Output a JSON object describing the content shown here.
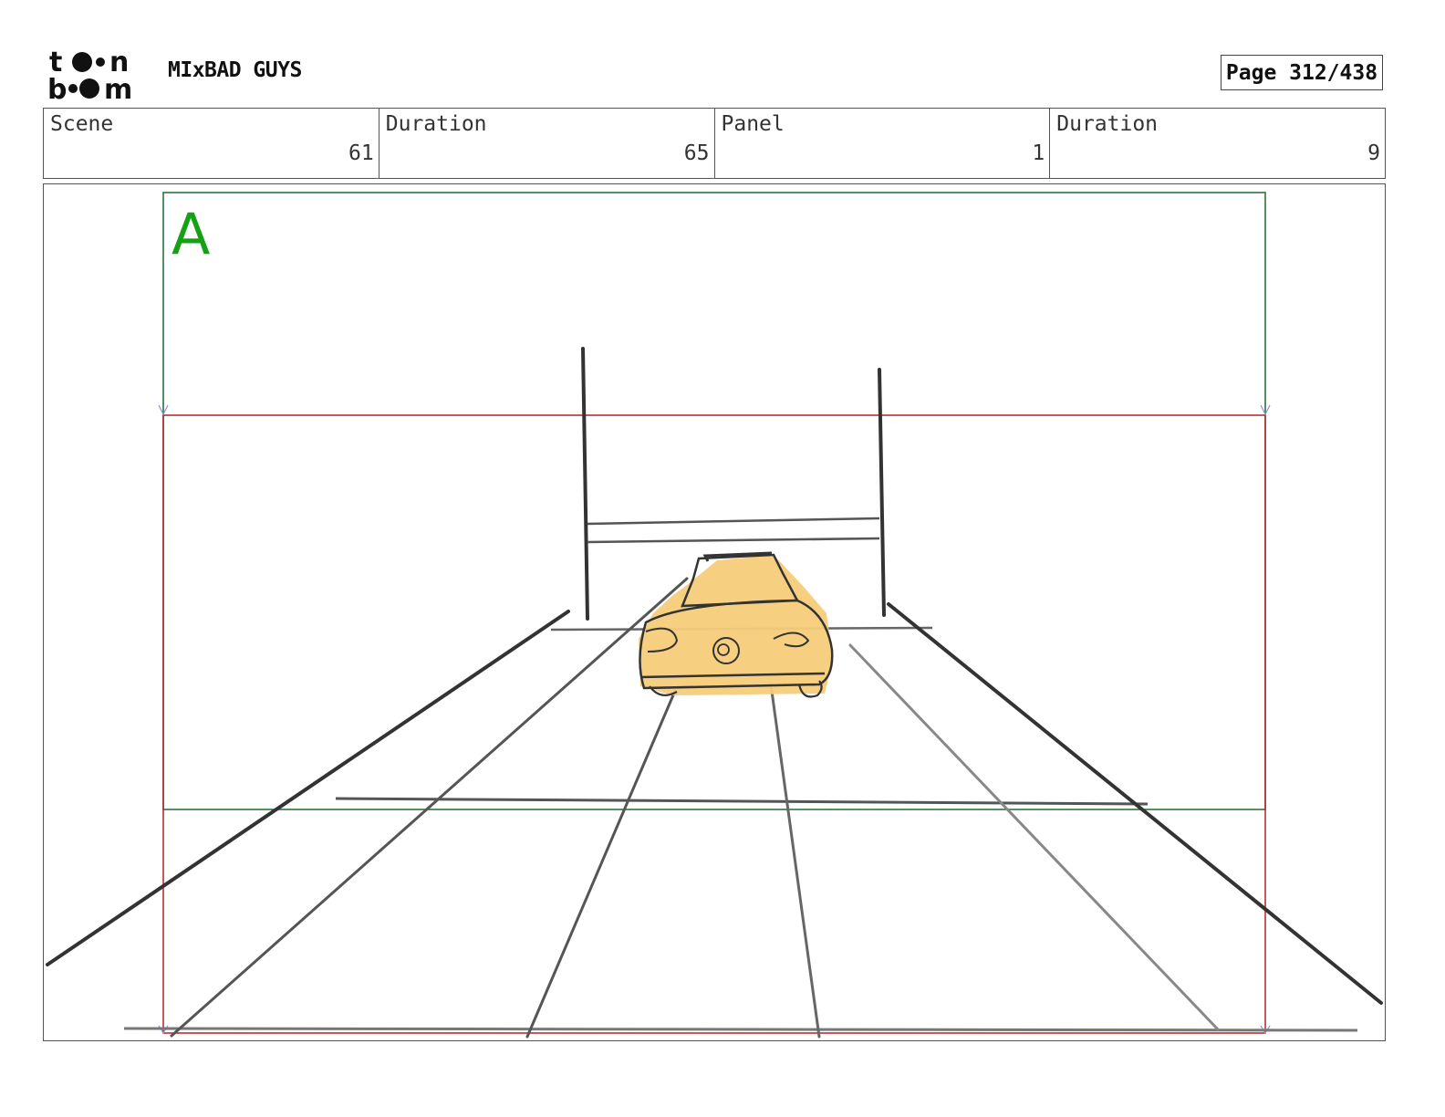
{
  "header": {
    "logo_alt": "toon boom",
    "show_title": "MIxBAD GUYS",
    "page_label": "Page 312/438"
  },
  "info": [
    {
      "label": "Scene",
      "value": "61"
    },
    {
      "label": "Duration",
      "value": "65"
    },
    {
      "label": "Panel",
      "value": "1"
    },
    {
      "label": "Duration",
      "value": "9"
    }
  ],
  "panel": {
    "field_letter": "A",
    "colors": {
      "field_guide": "#1e6b2e",
      "safe_frame": "#b22222",
      "field_letter": "#16a016",
      "car_fill": "#f6cc7a",
      "sketch_line": "#333333"
    }
  }
}
